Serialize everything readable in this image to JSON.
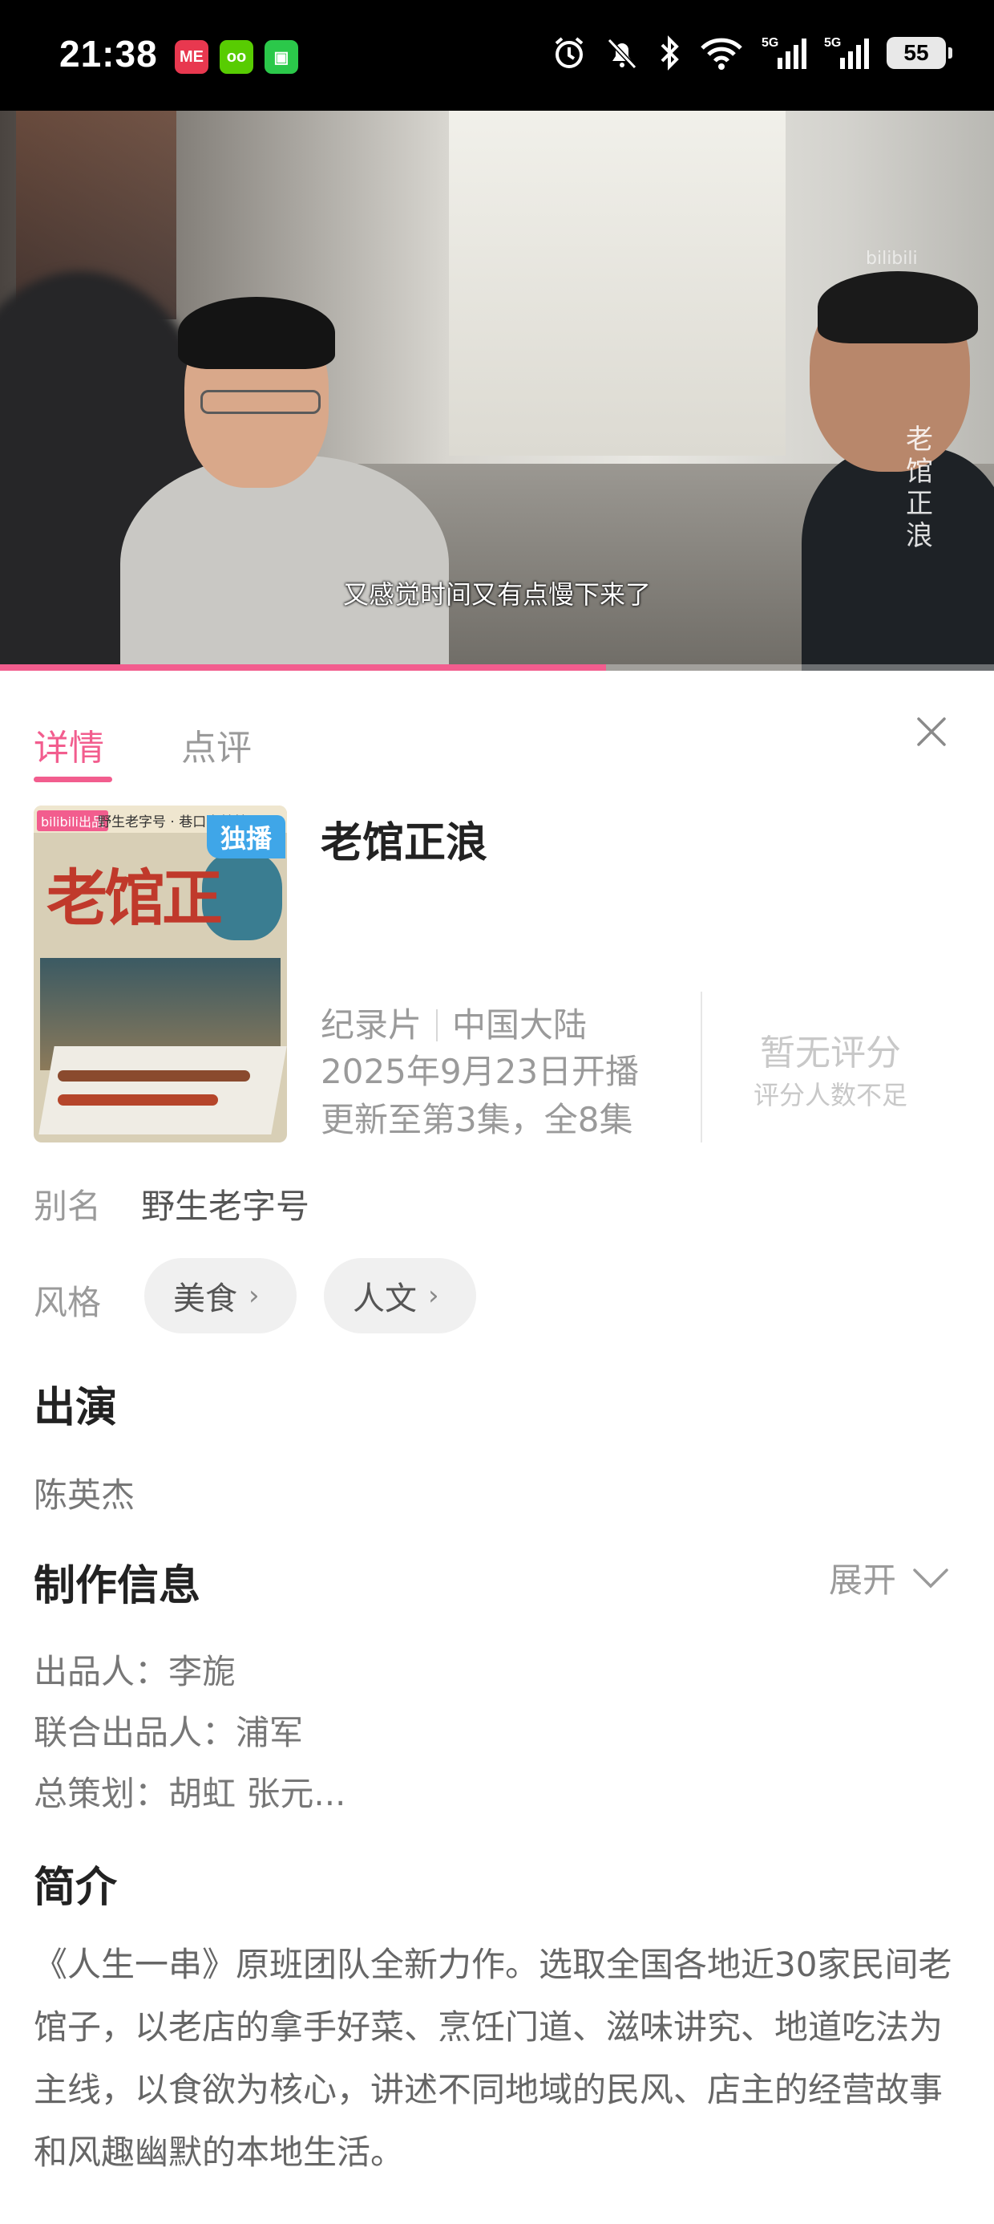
{
  "status_bar": {
    "time": "21:38",
    "app_icons": [
      {
        "name": "me-app-icon",
        "label": "ME",
        "color": "#e8384f"
      },
      {
        "name": "owl-app-icon",
        "label": "oo",
        "color": "#58cc02"
      },
      {
        "name": "chat-app-icon",
        "label": "▣",
        "color": "#2bc84a"
      }
    ],
    "indicators": [
      "alarm-icon",
      "mute-icon",
      "bluetooth-icon",
      "wifi-icon",
      "signal-5g-icon",
      "signal-5g-icon"
    ],
    "battery": "55"
  },
  "video": {
    "subtitle": "又感觉时间又有点慢下来了",
    "watermark": "老馆正浪",
    "progress": 0.61,
    "accent_color": "#f25d8e"
  },
  "tabs": [
    {
      "label": "详情",
      "active": true
    },
    {
      "label": "点评",
      "active": false
    }
  ],
  "show": {
    "cover_brand": "bilibili出品",
    "cover_subtitle": "野生老字号 · 巷口米其林",
    "cover_title": "老馆正",
    "badge": "独播",
    "title": "老馆正浪",
    "genre": "纪录片",
    "region": "中国大陆",
    "premiere": "2025年9月23日开播",
    "episodes": "更新至第3集，全8集",
    "rating": "暂无评分",
    "rating_note": "评分人数不足"
  },
  "alias": {
    "label": "别名",
    "value": "野生老字号"
  },
  "style": {
    "label": "风格",
    "tags": [
      "美食",
      "人文"
    ]
  },
  "cast": {
    "heading": "出演",
    "value": "陈英杰"
  },
  "production": {
    "heading": "制作信息",
    "expand_label": "展开",
    "lines": [
      "出品人：李旎",
      "联合出品人：浦军",
      "总策划：胡虹 张元..."
    ]
  },
  "synopsis": {
    "heading": "简介",
    "text": "《人生一串》原班团队全新力作。选取全国各地近30家民间老馆子，以老店的拿手好菜、烹饪门道、滋味讲究、地道吃法为主线，以食欲为核心，讲述不同地域的民风、店主的经营故事和风趣幽默的本地生活。"
  }
}
